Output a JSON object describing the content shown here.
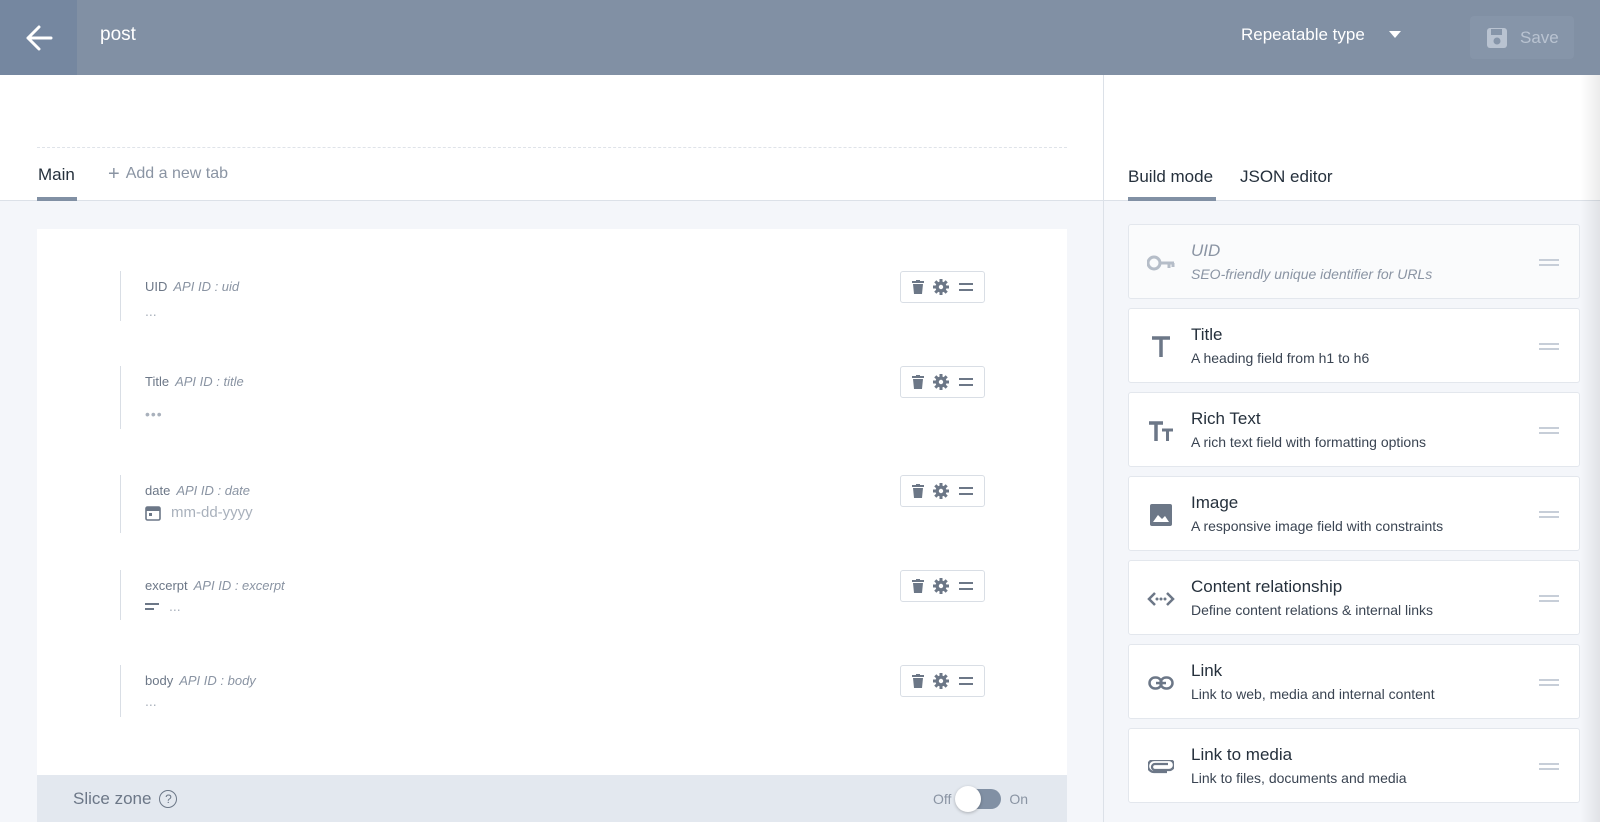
{
  "header": {
    "title": "post",
    "type_label": "Repeatable type",
    "save_label": "Save"
  },
  "tabs": {
    "main": "Main",
    "add": "Add a new tab"
  },
  "fields": [
    {
      "label": "UID",
      "api": "API ID : uid",
      "placeholder": "..."
    },
    {
      "label": "Title",
      "api": "API ID : title",
      "placeholder": "•••"
    },
    {
      "label": "date",
      "api": "API ID : date",
      "placeholder": "mm-dd-yyyy"
    },
    {
      "label": "excerpt",
      "api": "API ID : excerpt",
      "placeholder": "..."
    },
    {
      "label": "body",
      "api": "API ID : body",
      "placeholder": "..."
    }
  ],
  "slice_zone": {
    "label": "Slice zone",
    "help": "?",
    "off": "Off",
    "on": "On",
    "enabled": false
  },
  "right_tabs": {
    "build": "Build mode",
    "json": "JSON editor"
  },
  "widgets": [
    {
      "title": "UID",
      "desc": "SEO-friendly unique identifier for URLs",
      "icon": "key-icon"
    },
    {
      "title": "Title",
      "desc": "A heading field from h1 to h6",
      "icon": "title-t-icon"
    },
    {
      "title": "Rich Text",
      "desc": "A rich text field with formatting options",
      "icon": "rich-text-icon"
    },
    {
      "title": "Image",
      "desc": "A responsive image field with constraints",
      "icon": "image-icon"
    },
    {
      "title": "Content relationship",
      "desc": "Define content relations & internal links",
      "icon": "code-relationship-icon"
    },
    {
      "title": "Link",
      "desc": "Link to web, media and internal content",
      "icon": "link-icon"
    },
    {
      "title": "Link to media",
      "desc": "Link to files, documents and media",
      "icon": "paperclip-icon"
    }
  ],
  "colors": {
    "header": "#8190a4",
    "accent": "#8190a4",
    "background": "#f4f6fa"
  }
}
